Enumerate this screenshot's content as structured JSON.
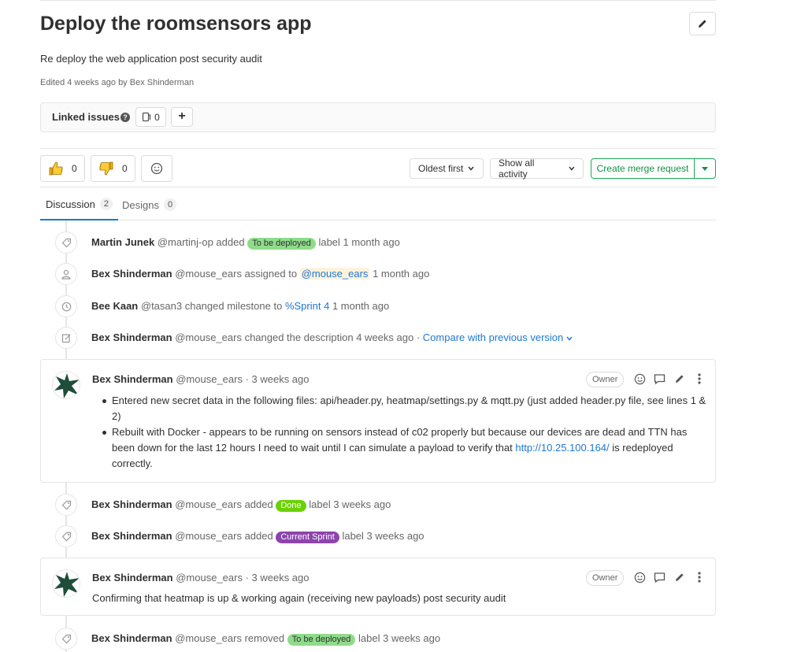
{
  "issue": {
    "title": "Deploy the roomsensors app",
    "description": "Re deploy the web application post security audit",
    "edited": "Edited 4 weeks ago by Bex Shinderman"
  },
  "linked_issues": {
    "title": "Linked issues",
    "count": "0"
  },
  "awards": {
    "thumbsup": "0",
    "thumbsdown": "0"
  },
  "toolbar": {
    "sort_label": "Oldest first",
    "filter_label": "Show all activity",
    "merge_label": "Create merge request"
  },
  "tabs": [
    {
      "label": "Discussion",
      "count": "2"
    },
    {
      "label": "Designs",
      "count": "0"
    }
  ],
  "activity": {
    "n1": {
      "author": "Martin Junek",
      "handle": "@martinj-op added",
      "label": "To be deployed",
      "label_color": "#8fdb8a",
      "after": "label 1 month ago"
    },
    "n2": {
      "author": "Bex Shinderman",
      "handle": "@mouse_ears assigned to",
      "mention": "@mouse_ears",
      "after": "1 month ago"
    },
    "n3": {
      "author": "Bee Kaan",
      "handle": "@tasan3 changed milestone to",
      "milestone": "%Sprint 4",
      "after": "1 month ago"
    },
    "n4": {
      "author": "Bex Shinderman",
      "handle": "@mouse_ears changed the description 4 weeks ago ·",
      "link": "Compare with previous version"
    },
    "c1": {
      "author": "Bex Shinderman",
      "meta": "@mouse_ears · 3 weeks ago",
      "role": "Owner",
      "b1": "Entered new secret data in the following files: api/header.py, heatmap/settings.py & mqtt.py (just added header.py file, see lines 1 & 2)",
      "b2_pre": "Rebuilt with Docker - appears to be running on sensors instead of c02 properly but because our devices are dead and TTN has been down for the last 12 hours I need to wait until I can simulate a payload to verify that",
      "b2_link": "http://10.25.100.164/",
      "b2_post": "is redeployed correctly."
    },
    "n5": {
      "author": "Bex Shinderman",
      "handle": "@mouse_ears added",
      "label": "Done",
      "label_color": "#69d100",
      "after": "label 3 weeks ago"
    },
    "n6": {
      "author": "Bex Shinderman",
      "handle": "@mouse_ears added",
      "label": "Current Sprint",
      "label_color": "#8e44ad",
      "after": "label 3 weeks ago"
    },
    "c2": {
      "author": "Bex Shinderman",
      "meta": "@mouse_ears · 3 weeks ago",
      "role": "Owner",
      "text": "Confirming that heatmap is up & working again (receiving new payloads) post security audit"
    },
    "n7": {
      "author": "Bex Shinderman",
      "handle": "@mouse_ears removed",
      "label": "To be deployed",
      "label_color": "#8fdb8a",
      "after": "label 3 weeks ago"
    }
  }
}
